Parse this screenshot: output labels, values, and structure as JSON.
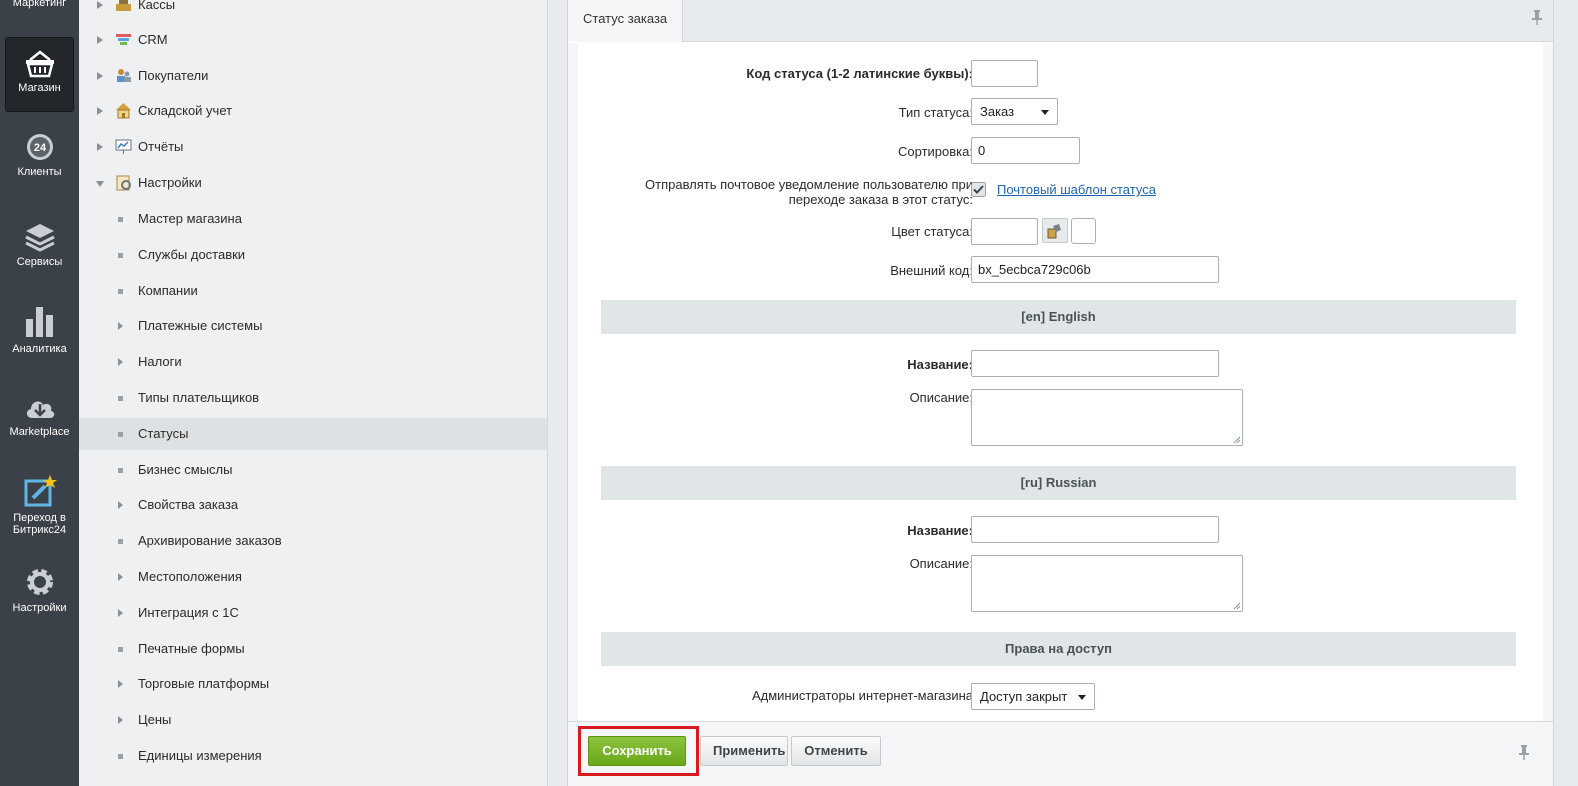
{
  "rail": {
    "items": [
      {
        "label": "Маркетинг"
      },
      {
        "label": "Магазин"
      },
      {
        "label": "Клиенты"
      },
      {
        "label": "Сервисы"
      },
      {
        "label": "Аналитика"
      },
      {
        "label": "Marketplace"
      },
      {
        "label": "Переход в Битрикс24"
      },
      {
        "label": "Настройки"
      }
    ],
    "badge_24": "24"
  },
  "menu": {
    "items": [
      {
        "label": "Кассы"
      },
      {
        "label": "CRM"
      },
      {
        "label": "Покупатели"
      },
      {
        "label": "Складской учет"
      },
      {
        "label": "Отчёты"
      },
      {
        "label": "Настройки"
      }
    ],
    "subitems": [
      {
        "label": "Мастер магазина"
      },
      {
        "label": "Службы доставки"
      },
      {
        "label": "Компании"
      },
      {
        "label": "Платежные системы"
      },
      {
        "label": "Налоги"
      },
      {
        "label": "Типы плательщиков"
      },
      {
        "label": "Статусы"
      },
      {
        "label": "Бизнес смыслы"
      },
      {
        "label": "Свойства заказа"
      },
      {
        "label": "Архивирование заказов"
      },
      {
        "label": "Местоположения"
      },
      {
        "label": "Интеграция с 1С"
      },
      {
        "label": "Печатные формы"
      },
      {
        "label": "Торговые платформы"
      },
      {
        "label": "Цены"
      },
      {
        "label": "Единицы измерения"
      }
    ]
  },
  "panel": {
    "tab_label": "Статус заказа",
    "form": {
      "code_label": "Код статуса (1-2 латинские буквы):",
      "code_value": "",
      "type_label": "Тип статуса:",
      "type_value": "Заказ",
      "sort_label": "Сортировка:",
      "sort_value": "0",
      "notify_label_line1": "Отправлять почтовое уведомление пользователю при",
      "notify_label_line2": "переходе заказа в этот статус:",
      "notify_checked": true,
      "mail_template_link": "Почтовый шаблон статуса",
      "color_label": "Цвет статуса:",
      "color_value": "",
      "ext_code_label": "Внешний код:",
      "ext_code_value": "bx_5ecbca729c06b"
    },
    "sections": {
      "en_title": "[en] English",
      "ru_title": "[ru] Russian",
      "access_title": "Права на доступ"
    },
    "lang_fields": {
      "name_label": "Название:",
      "desc_label": "Описание:"
    },
    "access": {
      "label": "Администраторы интернет-магазина",
      "value": "Доступ закрыт"
    },
    "buttons": {
      "save": "Сохранить",
      "apply": "Применить",
      "cancel": "Отменить"
    }
  },
  "colors": {
    "save_button": "#7ab52a",
    "highlight_border": "#d61a1f",
    "rail_bg": "#3b4148",
    "link": "#2067b0"
  }
}
